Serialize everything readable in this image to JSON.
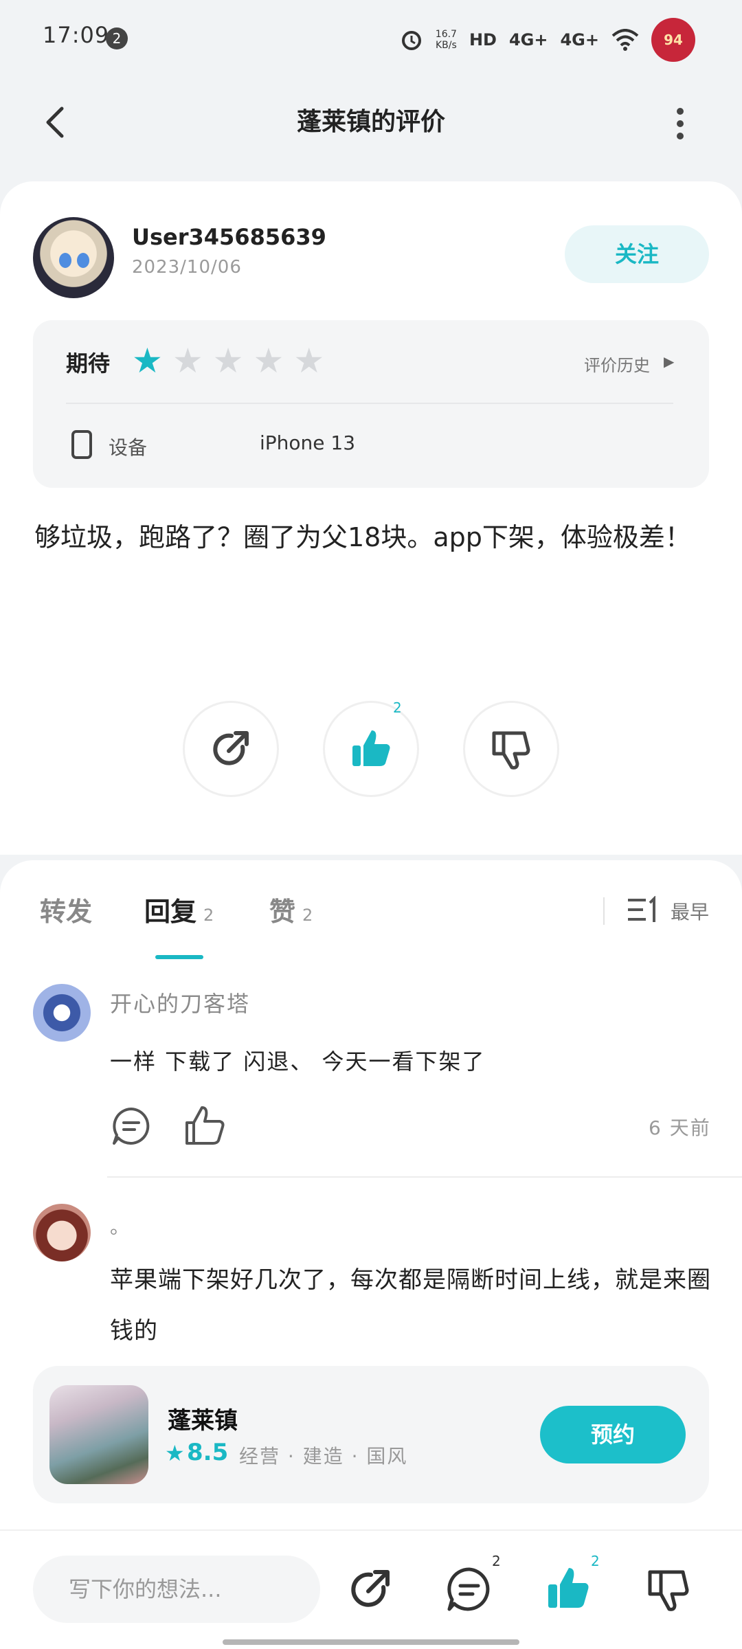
{
  "status_bar": {
    "time": "17:09",
    "notification_count": "2",
    "net_speed_value": "16.7",
    "net_speed_unit": "KB/s",
    "hd_label": "HD",
    "signal1": "4G+",
    "signal2": "4G+",
    "battery": "94"
  },
  "header": {
    "title": "蓬莱镇的评价"
  },
  "review": {
    "username": "User345685639",
    "date": "2023/10/06",
    "follow_label": "关注",
    "rating_label": "期待",
    "rating_value": 1,
    "rating_max": 5,
    "history_label": "评价历史",
    "device_label": "设备",
    "device_value": "iPhone 13",
    "text": "够垃圾，跑路了？圈了为父18块。app下架，体验极差！",
    "like_count": "2"
  },
  "tabs": {
    "forward": "转发",
    "reply": "回复",
    "reply_count": "2",
    "like": "赞",
    "like_count": "2",
    "sort_label": "最早"
  },
  "comments": [
    {
      "name": "开心的刀客塔",
      "text": "一样 下载了 闪退、 今天一看下架了",
      "time": "6 天前"
    },
    {
      "name": "。",
      "text": "苹果端下架好几次了，每次都是隔断时间上线，就是来圈钱的"
    }
  ],
  "game": {
    "name": "蓬莱镇",
    "score": "8.5",
    "tags": "经营 · 建造 · 国风",
    "reserve_label": "预约"
  },
  "bottom_bar": {
    "input_placeholder": "写下你的想法...",
    "comment_count": "2",
    "like_count": "2"
  },
  "colors": {
    "accent": "#1ab8c4",
    "star_inactive": "#d6d8db",
    "background": "#f1f3f5"
  }
}
